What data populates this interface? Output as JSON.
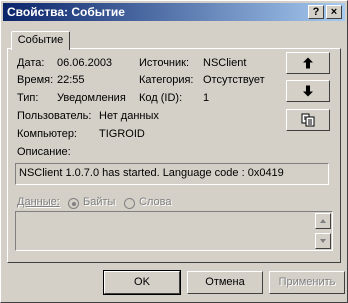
{
  "window": {
    "title": "Свойства: Событие",
    "help_button": "?",
    "close_button": "×"
  },
  "tabs": [
    {
      "label": "Событие"
    }
  ],
  "fields": {
    "date_label": "Дата:",
    "date_value": "06.06.2003",
    "time_label": "Время:",
    "time_value": "22:55",
    "type_label": "Тип:",
    "type_value": "Уведомления",
    "user_label": "Пользователь:",
    "user_value": "Нет данных",
    "computer_label": "Компьютер:",
    "computer_value": "TIGROID",
    "source_label": "Источник:",
    "source_value": "NSClient",
    "category_label": "Категория:",
    "category_value": "Отсутствует",
    "code_label": "Код (ID):",
    "code_value": "1"
  },
  "description": {
    "label": "Описание:",
    "text": "NSClient 1.0.7.0 has started. Language code : 0x0419"
  },
  "data_section": {
    "label": "Данные:",
    "option_bytes": "Байты",
    "option_words": "Слова",
    "selected": "Байты"
  },
  "buttons": {
    "ok": "OK",
    "cancel": "Отмена",
    "apply": "Применить"
  }
}
